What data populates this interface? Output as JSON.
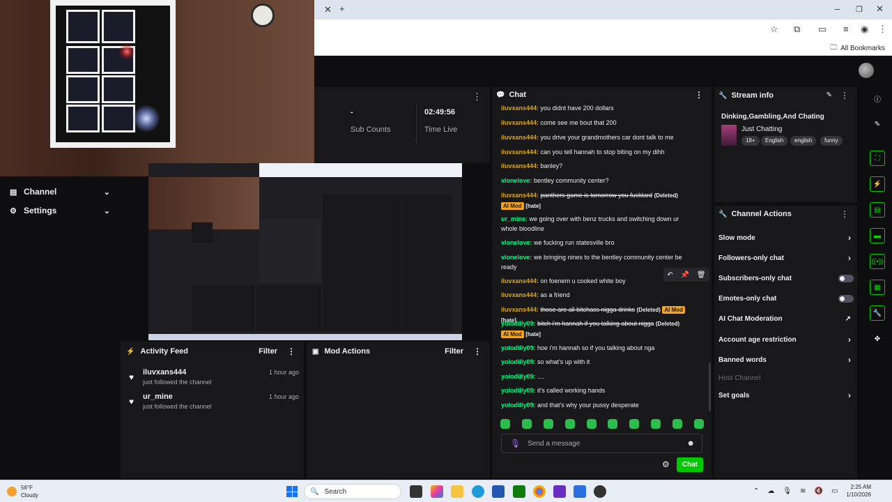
{
  "browser": {
    "add_tab": "+",
    "bookmarks_label": "All Bookmarks",
    "window_controls": [
      "minimize-icon",
      "restore-icon",
      "close-icon"
    ]
  },
  "left_nav": {
    "items": [
      {
        "label": "Channel",
        "icon": "broadcast-icon"
      },
      {
        "label": "Settings",
        "icon": "gear-icon"
      }
    ]
  },
  "stats": {
    "sub_counts_value": "-",
    "sub_counts_label": "Sub Counts",
    "time_live_value": "02:49:56",
    "time_live_label": "Time Live"
  },
  "activity_feed": {
    "title": "Activity Feed",
    "filter": "Filter",
    "items": [
      {
        "name": "iluvxans444",
        "text": "just followed the channel",
        "time": "1 hour ago"
      },
      {
        "name": "ur_mine",
        "text": "just followed the channel",
        "time": "1 hour ago"
      }
    ]
  },
  "mod_actions": {
    "title": "Mod Actions",
    "filter": "Filter"
  },
  "chat": {
    "title": "Chat",
    "input_placeholder": "Send a message",
    "send_label": "Chat",
    "user_colors": {
      "iluvxans444": "#daa520",
      "vlonelove": "#00ff7f",
      "ur_mine": "#00ff7f",
      "yolodilly09": "#00ff7f"
    },
    "messages": [
      {
        "user": "iluvxans444",
        "text": "you didnt have 200 dollars"
      },
      {
        "user": "iluvxans444",
        "text": "come see me bout that 200"
      },
      {
        "user": "iluvxans444",
        "text": "you drive your grandmothers car dont talk to me"
      },
      {
        "user": "iluvxans444",
        "text": "can you tell hannah to stop biting on my dihh"
      },
      {
        "user": "iluvxans444",
        "text": "banley?"
      },
      {
        "user": "vlonelove",
        "text": "bentley community center?"
      },
      {
        "user": "iluvxans444",
        "text": "panthers game is tomorrow you fucktard",
        "deleted": true
      },
      {
        "user": "ur_mine",
        "text": "we going over with benz trucks and switching down ur whole bloodline"
      },
      {
        "user": "vlonelove",
        "text": "we fucking run statesville bro"
      },
      {
        "user": "vlonelove",
        "text": "we bringing nines to the bentley community center be ready"
      },
      {
        "user": "iluvxans444",
        "text": "on foenem u cooked white boy"
      },
      {
        "user": "iluvxans444",
        "text": "as a friend"
      },
      {
        "user": "iluvxans444",
        "text": "those are all bitchass nigga drinks",
        "deleted": true
      },
      {
        "user": "yolodilly09",
        "text": "bitch i'm hannah if you talking about nigga",
        "deleted": true
      },
      {
        "user": "yolodilly09",
        "text": "hoe i'm hannah so if you talking about nga"
      },
      {
        "user": "yolodilly09",
        "text": "so what's up with it"
      },
      {
        "user": "yolodilly09",
        "text": "...."
      },
      {
        "user": "yolodilly09",
        "text": "it's called working hands"
      },
      {
        "user": "yolodilly09",
        "text": "and that's why your pussy desperate"
      }
    ],
    "deleted_tag": "(Deleted)",
    "ai_mod_badge": "AI Mod",
    "hate_tag": "[hate]"
  },
  "stream_info": {
    "title": "Stream info",
    "stream_title": "Dinking,Gambling,And Chating",
    "category": "Just Chatting",
    "tags": [
      "18+",
      "English",
      "english",
      "funny"
    ]
  },
  "channel_actions": {
    "title": "Channel Actions",
    "items": [
      {
        "label": "Slow mode",
        "control": "chevron"
      },
      {
        "label": "Followers-only chat",
        "control": "chevron"
      },
      {
        "label": "Subscribers-only chat",
        "control": "toggle"
      },
      {
        "label": "Emotes-only chat",
        "control": "toggle"
      },
      {
        "label": "AI Chat Moderation",
        "control": "external"
      },
      {
        "label": "Account age restriction",
        "control": "chevron"
      },
      {
        "label": "Banned words",
        "control": "chevron"
      },
      {
        "label": "Host Channel",
        "control": "none"
      },
      {
        "label": "Set goals",
        "control": "chevron"
      }
    ]
  },
  "taskbar": {
    "temperature": "56°F",
    "condition": "Cloudy",
    "search_label": "Search",
    "time": "2:25 AM",
    "date": "1/10/2026"
  }
}
